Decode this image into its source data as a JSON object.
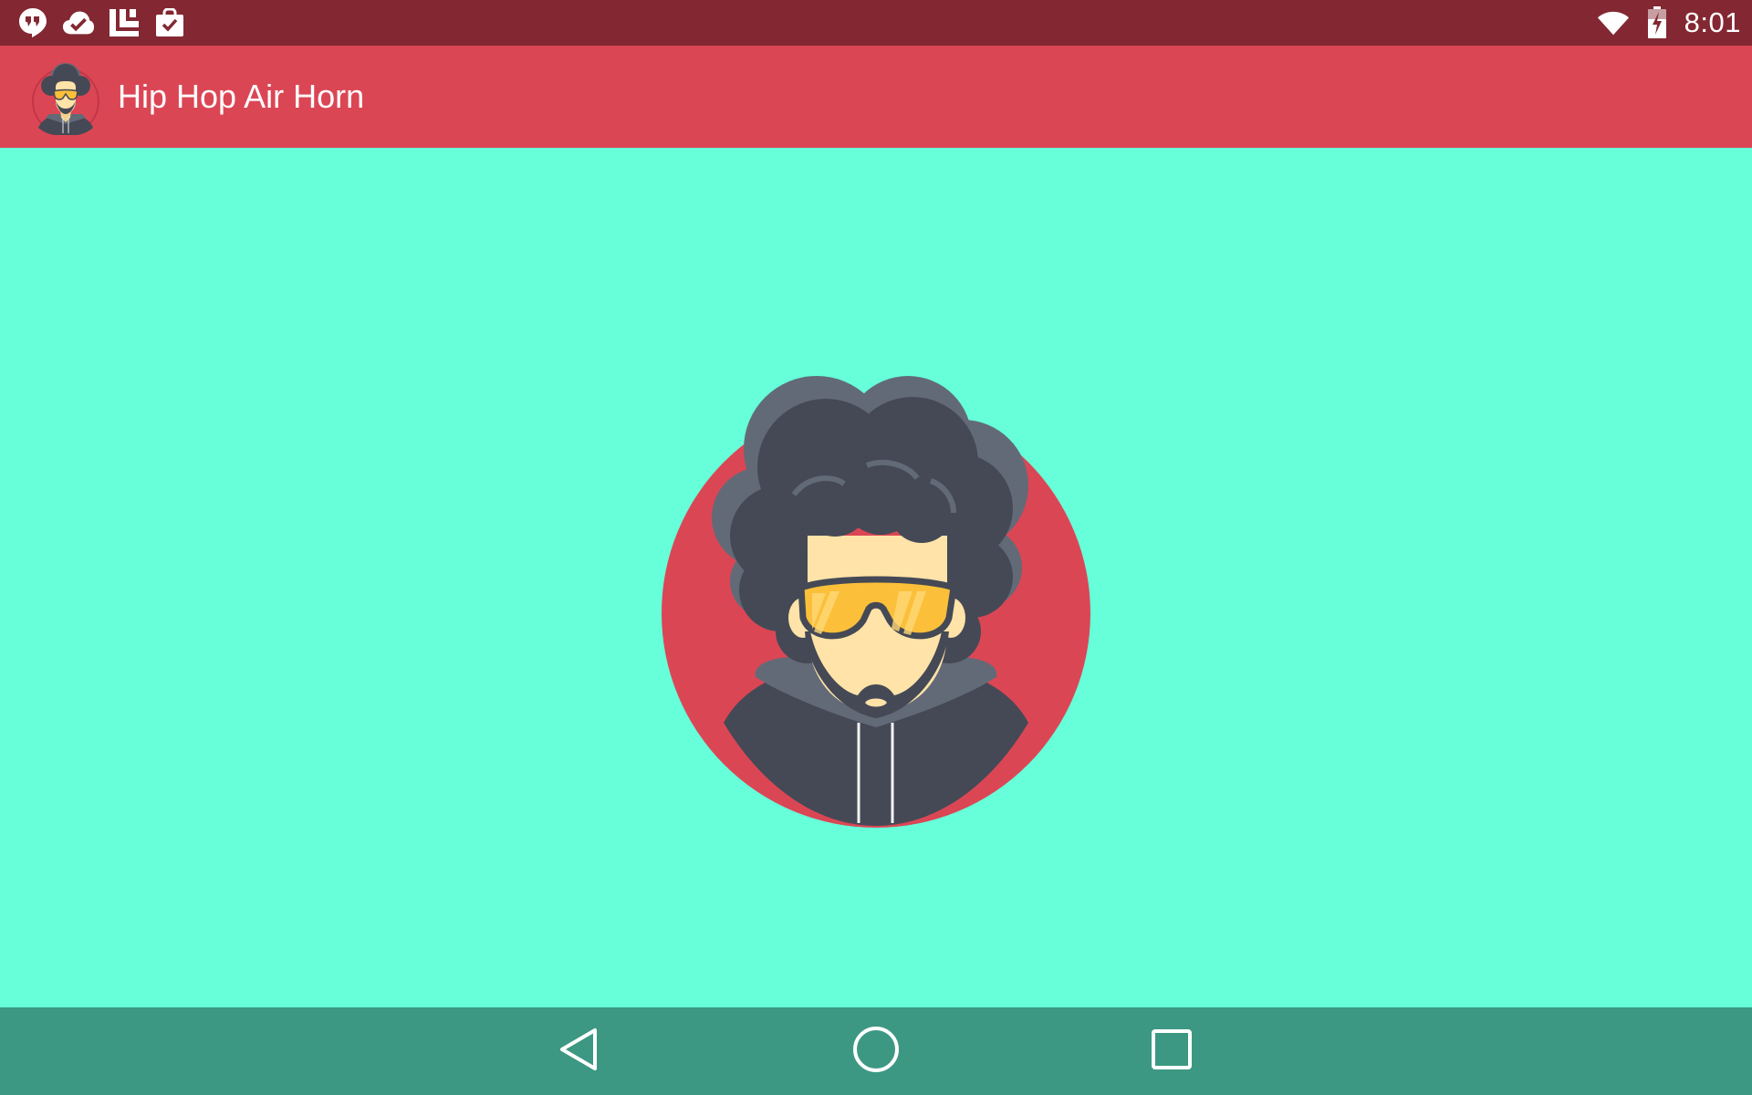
{
  "status_bar": {
    "notifications": [
      "hangouts-icon",
      "cloud-check-icon",
      "newsstand-icon",
      "play-store-bag-icon"
    ],
    "wifi_icon": "wifi-icon",
    "battery_icon": "battery-charging-icon",
    "time": "8:01"
  },
  "app_bar": {
    "icon": "hip-hop-avatar-icon",
    "title": "Hip Hop Air Horn"
  },
  "main": {
    "avatar_button": "hip-hop-avatar-button"
  },
  "nav_bar": {
    "back": "back-icon",
    "home": "home-icon",
    "recents": "recents-icon"
  },
  "colors": {
    "status_bar": "#832832",
    "app_bar": "#DB4655",
    "background": "#66FFD9",
    "nav_bar": "#3D9883",
    "avatar_circle": "#DB4655",
    "hair": "#444955",
    "hair_highlight": "#636A77",
    "skin": "#FFE3A8",
    "glasses": "#FBBF3A"
  }
}
